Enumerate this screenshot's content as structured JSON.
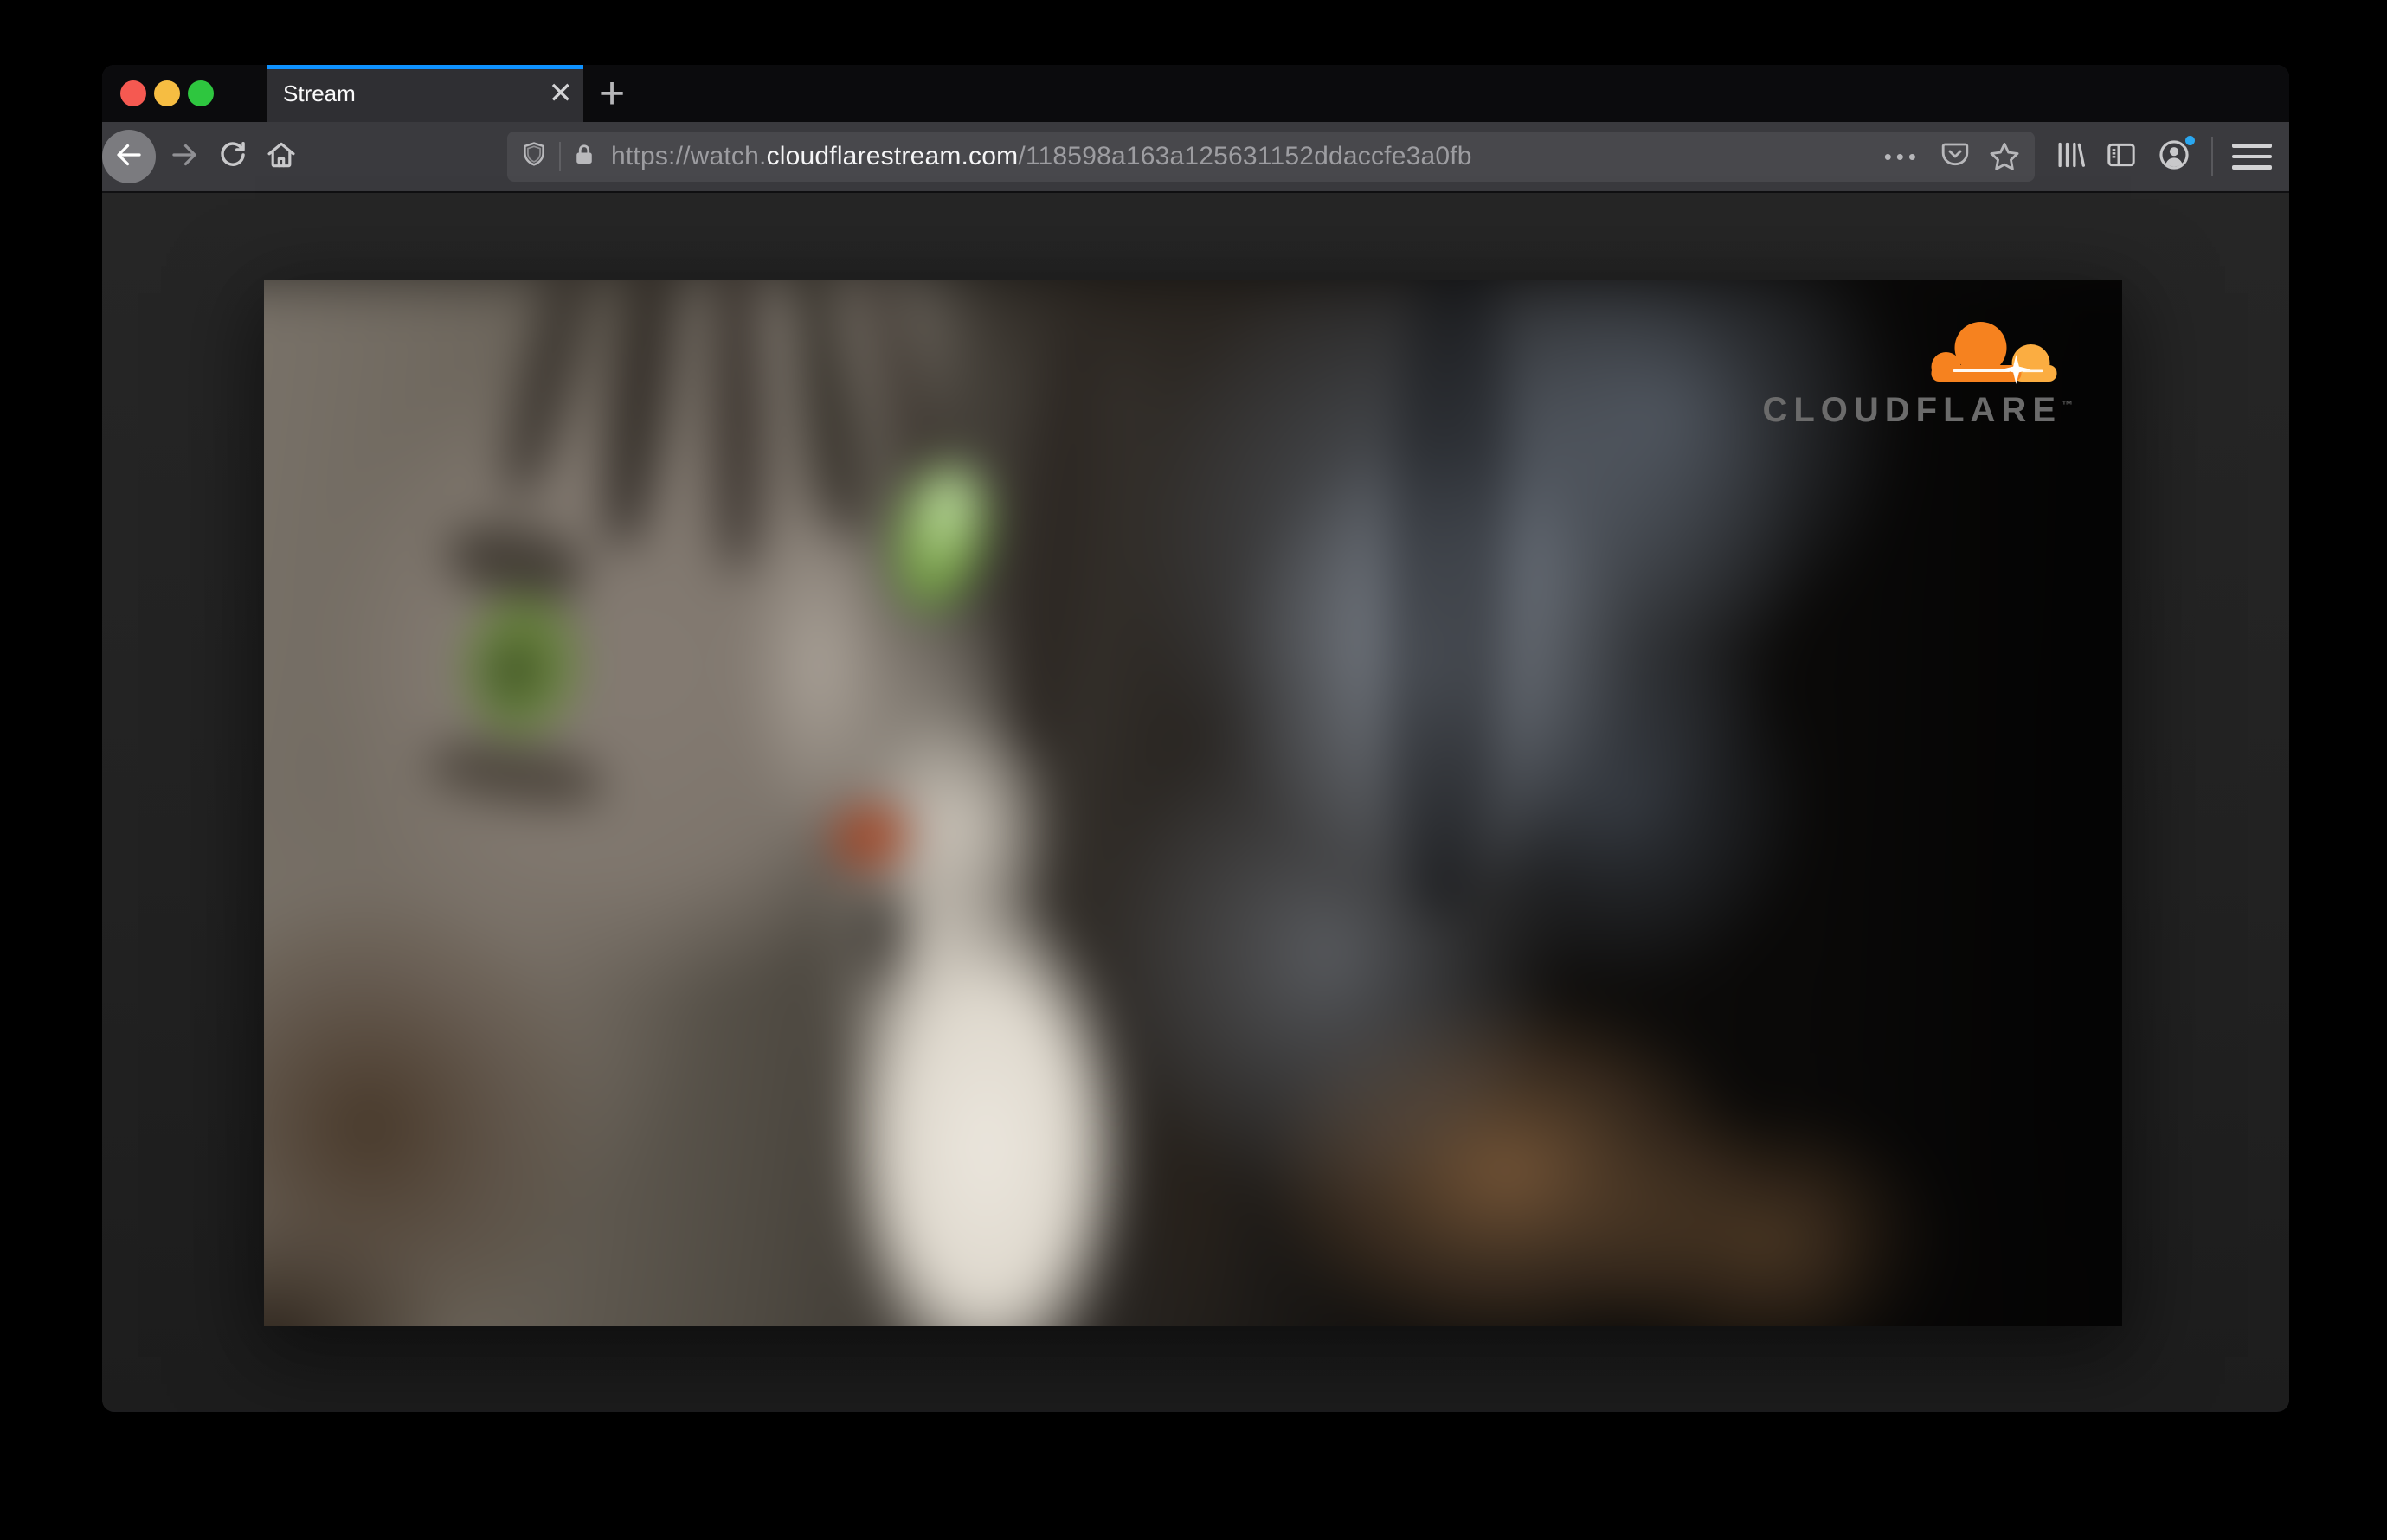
{
  "browser": {
    "window_controls": {
      "close_color": "#f55951",
      "minimize_color": "#f6bd42",
      "zoom_color": "#2ec63f"
    },
    "tab_bar": {
      "active_tab": {
        "title": "Stream",
        "close_glyph": "✕",
        "accent_color": "#0f92ff"
      },
      "new_tab_glyph": "+"
    },
    "toolbar": {
      "address": {
        "prefix": "https://watch.",
        "domain": "cloudflarestream.com",
        "path": "/118598a163a125631152ddaccfe3a0fb"
      },
      "page_actions_glyph": "•••",
      "account_notification_color": "#2aa7f0",
      "icons": {
        "back": "arrow-left-in-circle",
        "forward": "arrow-right",
        "reload": "circular-arrow",
        "home": "house",
        "tracking_protection": "shield",
        "connection_secure": "lock",
        "page_actions": "ellipsis",
        "save_to_pocket": "pocket-chevron",
        "bookmark": "star-outline",
        "library": "book-spines",
        "sidebar": "split-panel",
        "account": "person-in-circle",
        "menu": "hamburger"
      }
    }
  },
  "page": {
    "video_player": {
      "subject": "blurred close-up of a gray tabby cat with green eyes",
      "watermark": {
        "wordmark": "CLOUDFLARE",
        "trademark": "™",
        "cloud_color": "#f6821f",
        "cloud_highlight_color": "#fbad41"
      }
    }
  }
}
